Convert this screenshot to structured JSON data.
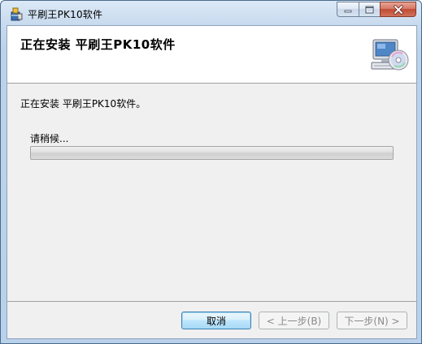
{
  "window": {
    "title": "平刷王PK10软件"
  },
  "banner": {
    "title": "正在安装 平刷王PK10软件"
  },
  "main": {
    "status_text": "正在安装 平刷王PK10软件。",
    "wait_label": "请稍候...",
    "progress_fraction": 0.0
  },
  "footer": {
    "cancel_label": "取消",
    "back_label": "< 上一步(B)",
    "next_label": "下一步(N) >"
  },
  "icons": {
    "app": "installer-package-icon",
    "banner": "computer-cd-icon",
    "minimize": "minimize-icon",
    "maximize": "maximize-icon",
    "close": "close-icon"
  },
  "colors": {
    "title_bar": "#c8daee",
    "close_button": "#c75050",
    "banner_bg": "#ffffff",
    "body_bg": "#f0f0f0",
    "default_button_border": "#3c7fb1"
  }
}
